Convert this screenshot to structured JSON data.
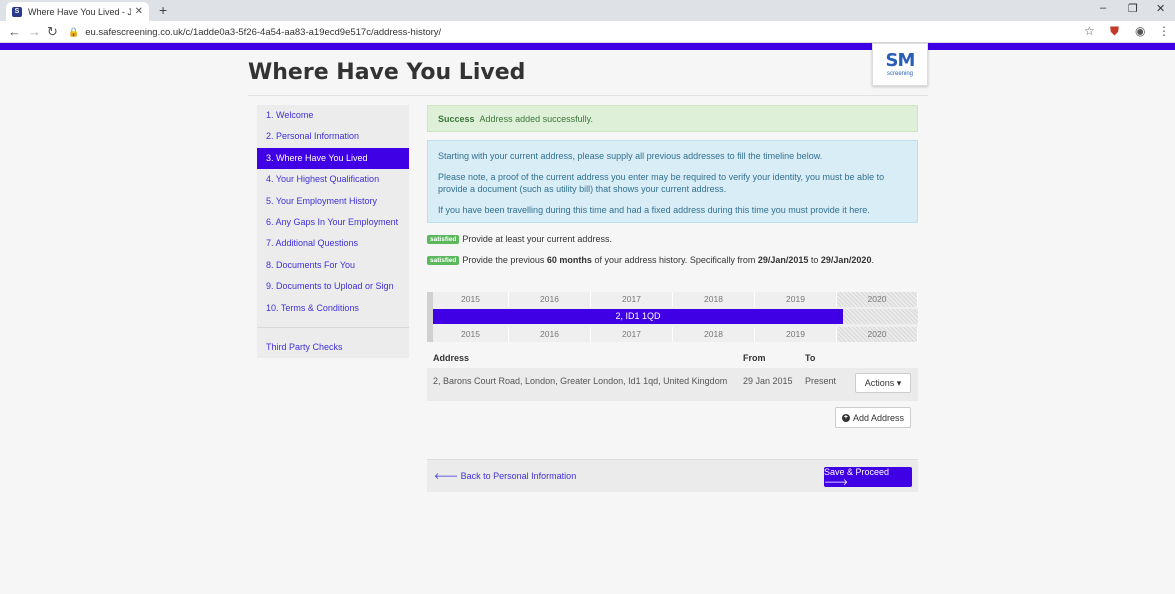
{
  "browser": {
    "tab_title": "Where Have You Lived - John Do",
    "tab_favicon": "S",
    "tab_close": "✕",
    "new_tab": "+",
    "minimize": "–",
    "restore": "❐",
    "close_window": "✕",
    "back": "←",
    "forward": "→",
    "reload": "↻",
    "url": "eu.safescreening.co.uk/c/1adde0a3-5f26-4a54-aa83-a19ecd9e517c/address-history/",
    "star": "☆",
    "menu": "⋮",
    "profile": "◉",
    "extension": "⛊"
  },
  "logo": {
    "mark": "SM",
    "sub": "screening"
  },
  "page": {
    "title": "Where Have You Lived"
  },
  "sidebar": {
    "items": [
      {
        "label": "1. Welcome",
        "active": false
      },
      {
        "label": "2. Personal Information",
        "active": false
      },
      {
        "label": "3. Where Have You Lived",
        "active": true
      },
      {
        "label": "4. Your Highest Qualification",
        "active": false
      },
      {
        "label": "5. Your Employment History",
        "active": false
      },
      {
        "label": "6. Any Gaps In Your Employment",
        "active": false
      },
      {
        "label": "7. Additional Questions",
        "active": false
      },
      {
        "label": "8. Documents For You",
        "active": false
      },
      {
        "label": "9. Documents to Upload or Sign",
        "active": false
      },
      {
        "label": "10. Terms & Conditions",
        "active": false
      }
    ],
    "third_party": "Third Party Checks"
  },
  "alert_success": {
    "strong": "Success",
    "text": "Address added successfully."
  },
  "alert_info": {
    "p1": "Starting with your current address, please supply all previous addresses to fill the timeline below.",
    "p2": "Please note, a proof of the current address you enter may be required to verify your identity, you must be able to provide a document (such as utility bill) that shows your current address.",
    "p3": "If you have been travelling during this time and had a fixed address during this time you must provide it here."
  },
  "requirements": {
    "badge": "satisfied",
    "r1": "Provide at least your current address.",
    "r2_pre": "Provide the previous ",
    "r2_months": "60 months",
    "r2_mid": " of your address history. Specifically from ",
    "r2_from": "29/Jan/2015",
    "r2_to_word": " to ",
    "r2_to": "29/Jan/2020",
    "r2_end": "."
  },
  "timeline": {
    "years": [
      "2015",
      "2016",
      "2017",
      "2018",
      "2019",
      "2020"
    ],
    "bar_label": "2, ID1 1QD"
  },
  "table": {
    "headers": {
      "address": "Address",
      "from": "From",
      "to": "To"
    },
    "rows": [
      {
        "address": "2, Barons Court Road, London, Greater London, Id1 1qd, United Kingdom",
        "from": "29 Jan 2015",
        "to": "Present",
        "actions": "Actions ▾"
      }
    ]
  },
  "add_address": "Add Address",
  "footer": {
    "back": "🡐 Back to Personal Information",
    "save": "Save & Proceed 🡒"
  }
}
